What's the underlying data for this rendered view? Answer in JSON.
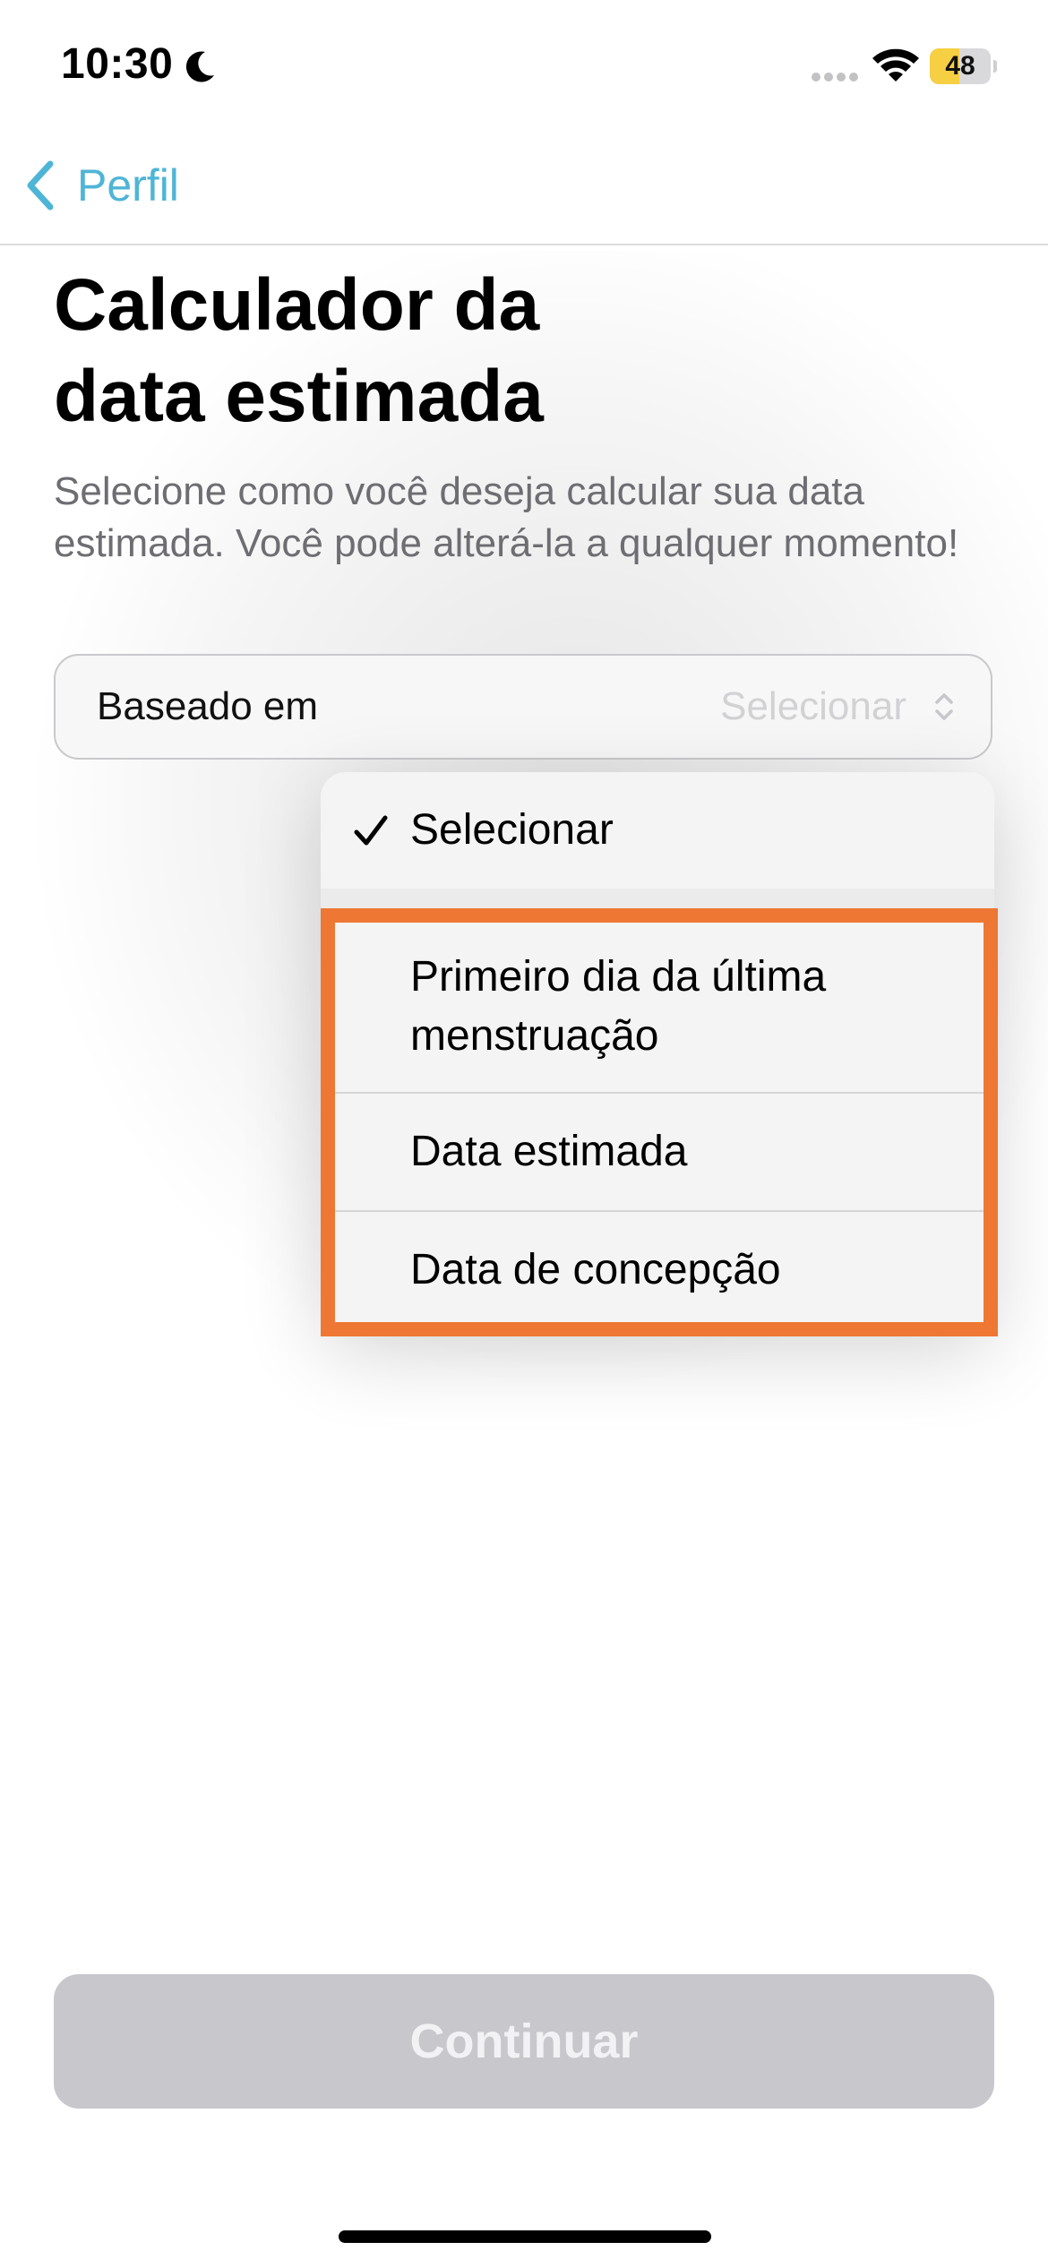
{
  "status_bar": {
    "time": "10:30",
    "battery_level": "48",
    "battery_fraction": 0.48,
    "battery_color": "#f7cf43"
  },
  "nav": {
    "back_label": "Perfil",
    "accent_color": "#4fb5d6"
  },
  "page": {
    "title_line1": "Calculador da",
    "title_line2": "data estimada",
    "subtitle": "Selecione como você deseja calcular sua data estimada. Você pode alterá-la a qualquer momento!"
  },
  "select": {
    "label": "Baseado em",
    "value": "Selecionar"
  },
  "menu": {
    "selected": "Selecionar",
    "items": [
      {
        "label": "Primeiro dia da última menstruação"
      },
      {
        "label": "Data estimada"
      },
      {
        "label": "Data de concepção"
      }
    ]
  },
  "highlight": {
    "color": "#ee7734"
  },
  "actions": {
    "continue_label": "Continuar"
  },
  "icons": [
    "moon-icon",
    "signal-icon",
    "wifi-icon",
    "back-chevron-icon",
    "chevron-updown-icon",
    "check-icon"
  ]
}
